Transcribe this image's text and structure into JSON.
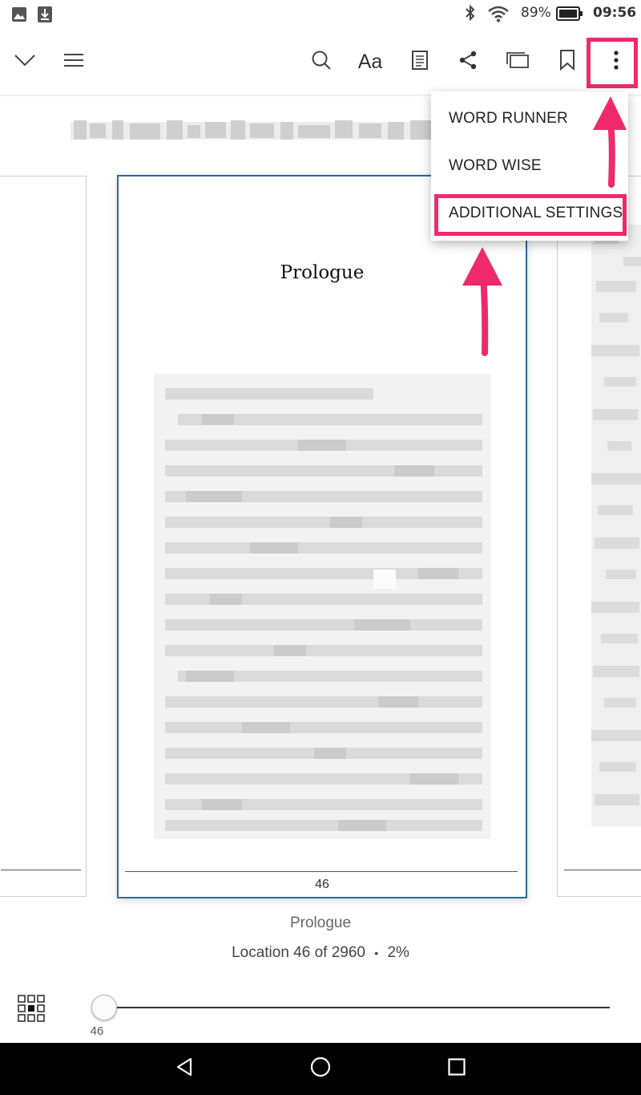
{
  "status_bar": {
    "battery_percent": "89%",
    "time": "09:56",
    "icons": [
      "image-notification-icon",
      "download-notification-icon",
      "bluetooth-icon",
      "wifi-icon",
      "battery-icon"
    ]
  },
  "toolbar": {
    "icons": [
      "chevron-down-icon",
      "menu-icon",
      "search-icon",
      "font-settings-icon",
      "notes-icon",
      "share-icon",
      "page-flip-icon",
      "bookmark-icon",
      "more-options-icon"
    ],
    "font_label": "Aa"
  },
  "menu": {
    "items": [
      {
        "label": "WORD RUNNER"
      },
      {
        "label": "WORD WISE"
      },
      {
        "label": "ADDITIONAL SETTINGS"
      }
    ]
  },
  "page": {
    "chapter_title": "Prologue",
    "page_number": "46"
  },
  "footer": {
    "chapter": "Prologue",
    "location_text": "Location 46 of 2960",
    "separator": "•",
    "percent": "2%"
  },
  "slider": {
    "value_label": "46",
    "position_fraction": 0.016
  },
  "colors": {
    "highlight": "#ee2a6b",
    "page_border": "#2b6aa0",
    "nav_bar": "#000000"
  }
}
